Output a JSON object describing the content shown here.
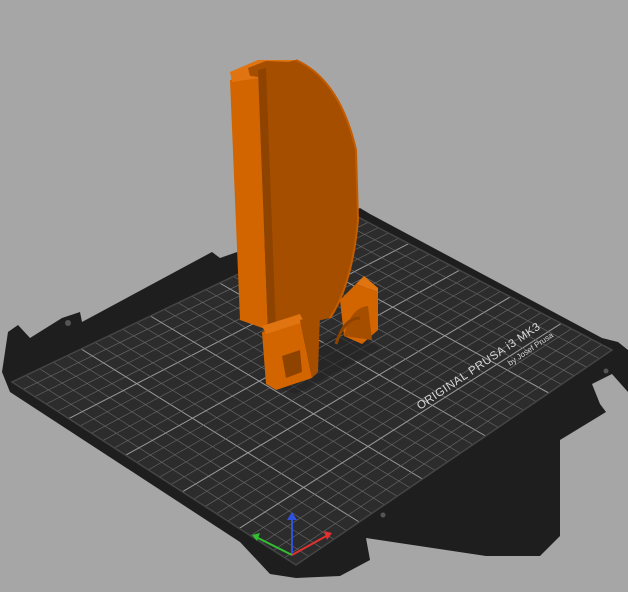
{
  "viewport": {
    "background": "#a6a6a6"
  },
  "bed": {
    "brand_line": "ORIGINAL PRUSA i3 MK3",
    "maker_line": "by Josef Prusa",
    "plate_color": "#2c2c2c",
    "frame_color": "#1e1e1e",
    "grid_color": "#6a6a6a",
    "major_grid_color": "#9a9a9a"
  },
  "model": {
    "name": "orange part",
    "face_color": "#a64e00",
    "side_color": "#d36500",
    "edge_color": "#e07410"
  },
  "axes": {
    "x_color": "#e03030",
    "y_color": "#30c030",
    "z_color": "#3050e0"
  }
}
